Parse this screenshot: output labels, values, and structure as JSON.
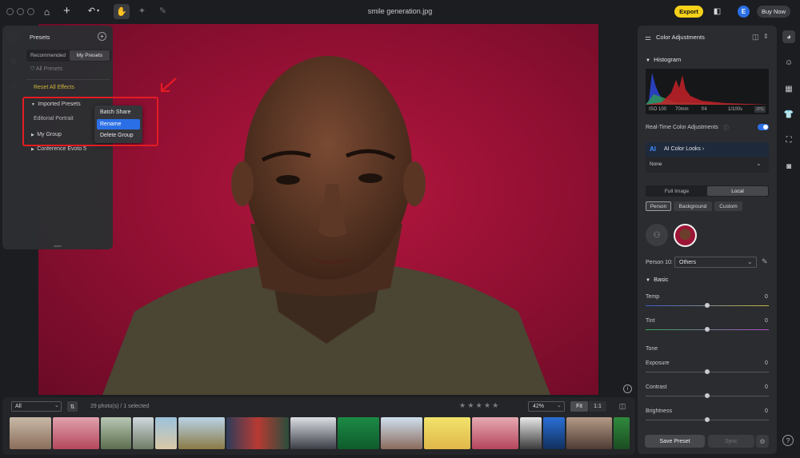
{
  "window": {
    "title": "smile generation.jpg"
  },
  "toolbar": {
    "export_label": "Export",
    "avatar_letter": "E",
    "buy_now_label": "Buy Now"
  },
  "presets": {
    "header": "Presets",
    "tabs": [
      "Recommended",
      "My Presets"
    ],
    "filter_label": "All Presets",
    "reset_label": "Reset All Effects",
    "groups": [
      "Imported Presets",
      "Editorial Portrait",
      "My Group",
      "Conference Evoto 5"
    ],
    "context_menu": [
      "Batch Share",
      "Rename",
      "Delete Group"
    ]
  },
  "color_adjustments": {
    "header": "Color Adjustments",
    "histogram_label": "Histogram",
    "exif": {
      "iso": "ISO 100",
      "focal": "70mm",
      "aperture": "f/4",
      "shutter": "1/100s",
      "format": "JPG"
    },
    "realtime_label": "Real-Time Color Adjustments",
    "ai_looks_label": "AI Color Looks",
    "ai_looks_value": "None",
    "scope_tabs": [
      "Full Image",
      "Local"
    ],
    "local_tabs": [
      "Person",
      "Background",
      "Custom"
    ],
    "person_label": "Person 10:",
    "person_value": "Others",
    "basic_label": "Basic",
    "temp": {
      "label": "Temp",
      "value": "0"
    },
    "tint": {
      "label": "Tint",
      "value": "0"
    },
    "tone_label": "Tone",
    "exposure": {
      "label": "Exposure",
      "value": "0"
    },
    "contrast": {
      "label": "Contrast",
      "value": "0"
    },
    "brightness": {
      "label": "Brightness",
      "value": "0"
    },
    "save_preset_label": "Save Preset",
    "sync_label": "Sync"
  },
  "filmstrip": {
    "filter_value": "All",
    "count_text": "29 photo(s) / 1 selected",
    "zoom_value": "42%",
    "fit_label": "Fit",
    "one_to_one_label": "1:1"
  },
  "colors": {
    "accent_yellow": "#f5d11a",
    "selection_blue": "#2b6fe6",
    "highlight_red": "#e31b23",
    "backdrop": "#8d0f31"
  }
}
